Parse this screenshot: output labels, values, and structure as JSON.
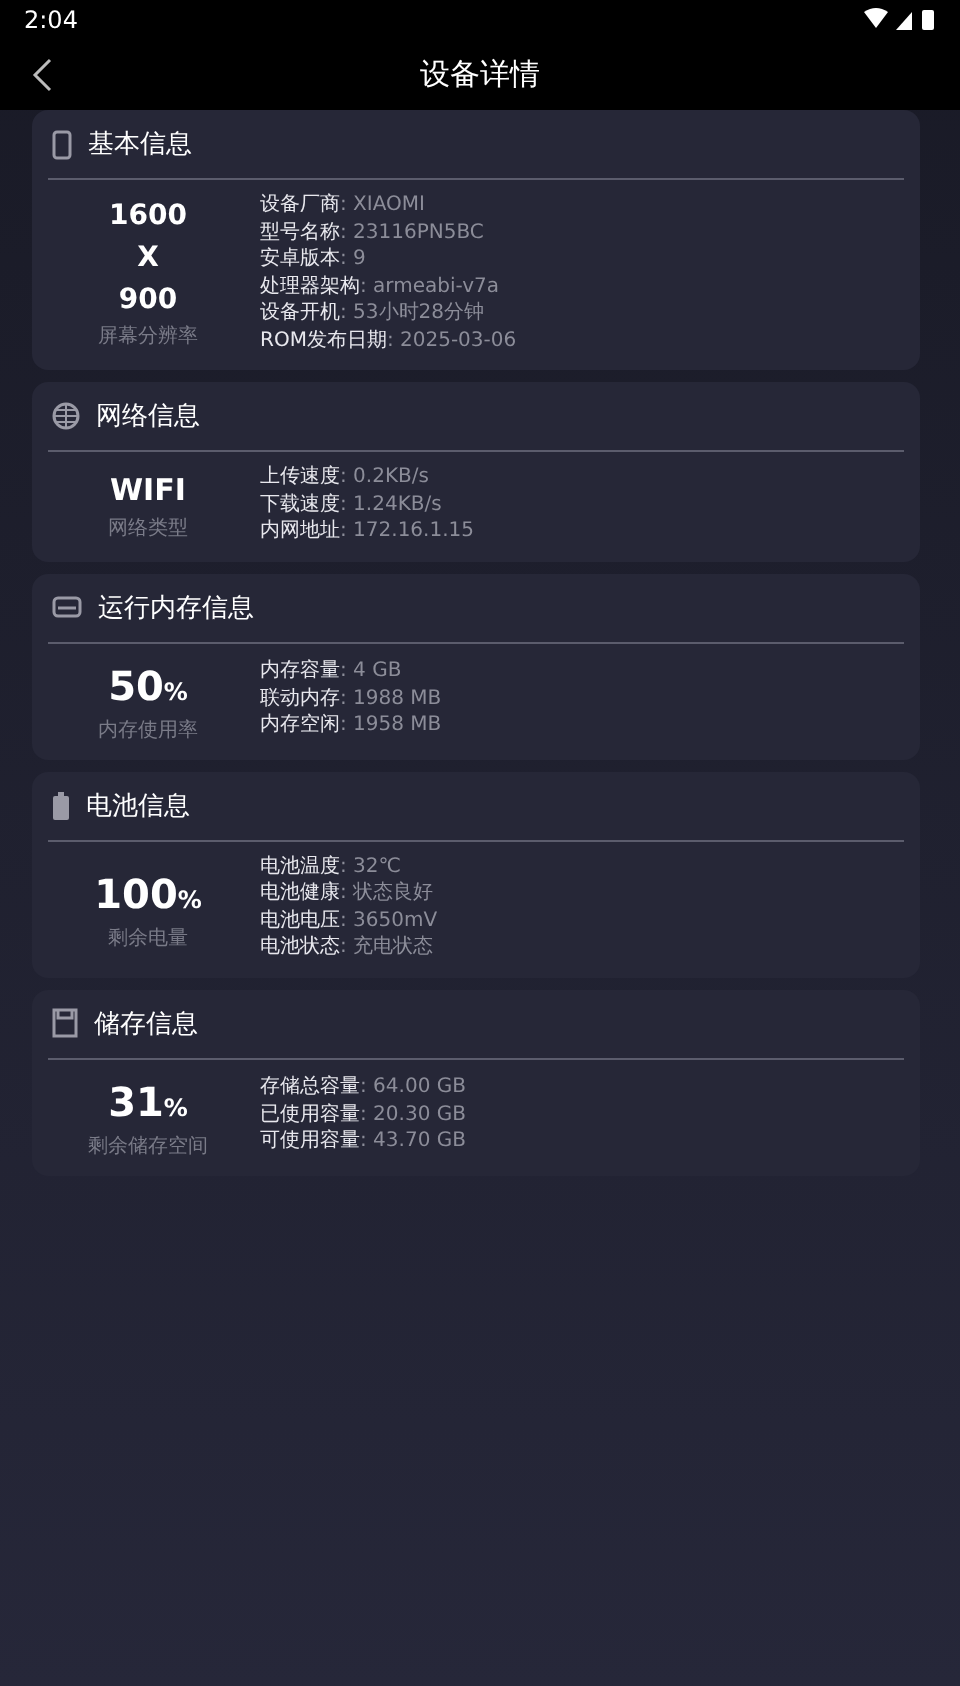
{
  "status_bar": {
    "time": "2:04"
  },
  "header": {
    "title": "设备详情"
  },
  "sections": [
    {
      "kind": "phone",
      "title": "基本信息",
      "big": {
        "lines": [
          "1600",
          "X",
          "900"
        ]
      },
      "caption": "屏幕分辨率",
      "rows": [
        {
          "label": "设备厂商",
          "value": ": XIAOMI"
        },
        {
          "label": "型号名称",
          "value": ": 23116PN5BC"
        },
        {
          "label": "安卓版本",
          "value": ": 9"
        },
        {
          "label": "处理器架构",
          "value": ": armeabi-v7a"
        },
        {
          "label": "设备开机",
          "value": ": 53小时28分钟"
        },
        {
          "label": "ROM发布日期",
          "value": ": 2025-03-06"
        }
      ]
    },
    {
      "kind": "globe",
      "title": "网络信息",
      "big": {
        "value": "WIFI"
      },
      "caption": "网络类型",
      "rows": [
        {
          "label": "上传速度",
          "value": ": 0.2KB/s"
        },
        {
          "label": "下载速度",
          "value": ": 1.24KB/s"
        },
        {
          "label": "内网地址",
          "value": ": 172.16.1.15"
        }
      ]
    },
    {
      "kind": "memory",
      "title": "运行内存信息",
      "big": {
        "value": "50",
        "unit": "%"
      },
      "caption": "内存使用率",
      "rows": [
        {
          "label": "内存容量",
          "value": ": 4 GB"
        },
        {
          "label": "联动内存",
          "value": ": 1988 MB"
        },
        {
          "label": "内存空闲",
          "value": ": 1958 MB"
        }
      ]
    },
    {
      "kind": "battery",
      "title": "电池信息",
      "big": {
        "value": "100",
        "unit": "%"
      },
      "caption": "剩余电量",
      "rows": [
        {
          "label": "电池温度",
          "value": ": 32℃"
        },
        {
          "label": "电池健康",
          "value": ": 状态良好"
        },
        {
          "label": "电池电压",
          "value": ": 3650mV"
        },
        {
          "label": "电池状态",
          "value": ": 充电状态"
        }
      ]
    },
    {
      "kind": "sdcard",
      "title": "储存信息",
      "big": {
        "value": "31",
        "unit": "%"
      },
      "caption": "剩余储存空间",
      "rows": [
        {
          "label": "存储总容量",
          "value": ": 64.00 GB"
        },
        {
          "label": "已使用容量",
          "value": ": 20.30 GB"
        },
        {
          "label": "可使用容量",
          "value": ": 43.70 GB"
        }
      ]
    }
  ]
}
